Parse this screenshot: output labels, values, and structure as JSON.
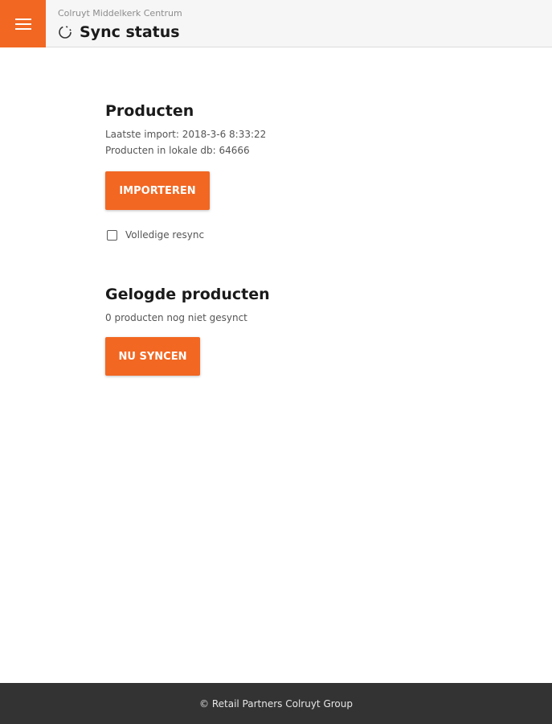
{
  "header": {
    "store_name": "Colruyt Middelkerk Centrum",
    "title": "Sync status",
    "menu_icon": "hamburger-menu-icon",
    "status_icon": "sync-spinner-icon",
    "accent_color": "#f26722"
  },
  "products": {
    "heading": "Producten",
    "last_import": "Laatste import: 2018-3-6 8:33:22",
    "local_db_count": "Producten in lokale db: 64666",
    "import_button": "IMPORTEREN",
    "full_resync_label": "Volledige resync",
    "full_resync_checked": false
  },
  "logged_products": {
    "heading": "Gelogde producten",
    "status": "0 producten nog niet gesynct",
    "sync_button": "NU SYNCEN"
  },
  "footer": {
    "text": "© Retail Partners Colruyt Group"
  }
}
